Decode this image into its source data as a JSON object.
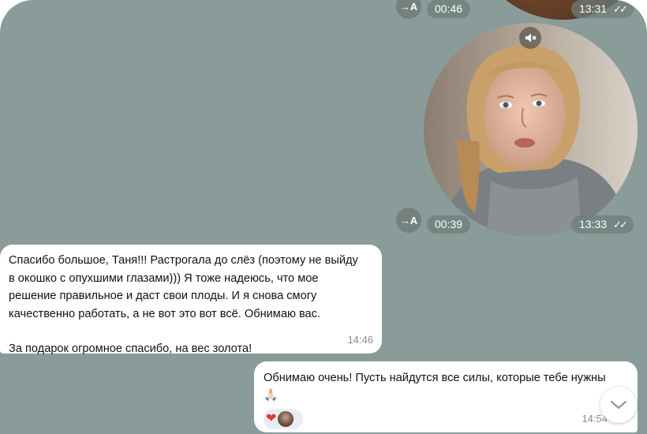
{
  "top_message": {
    "video_duration": "00:46",
    "time": "13:31",
    "translate_icon": "→A"
  },
  "video_note": {
    "duration": "00:39",
    "time": "13:33",
    "translate_icon": "→A",
    "muted": true
  },
  "incoming_message": {
    "lines": [
      "Спасибо большое, Таня!!! Растрогала до слёз (поэтому не выйду",
      "в окошко с опухшими глазами))) Я тоже надеюсь, что мое",
      "решение правильное и даст свои плоды. И я снова смогу",
      "качественно работать, а не вот это вот всё. Обнимаю вас."
    ],
    "last_line": "За подарок огромное спасибо, на вес золота!",
    "time": "14:46"
  },
  "outgoing_message": {
    "text": "Обнимаю очень! Пусть найдутся все силы, которые тебе нужны",
    "emoji": "🙏🏻",
    "reaction": "❤",
    "time": "14:54"
  },
  "colors": {
    "chat_background": "#8a9c99",
    "bubble": "#ffffff",
    "heart": "#e53935"
  }
}
